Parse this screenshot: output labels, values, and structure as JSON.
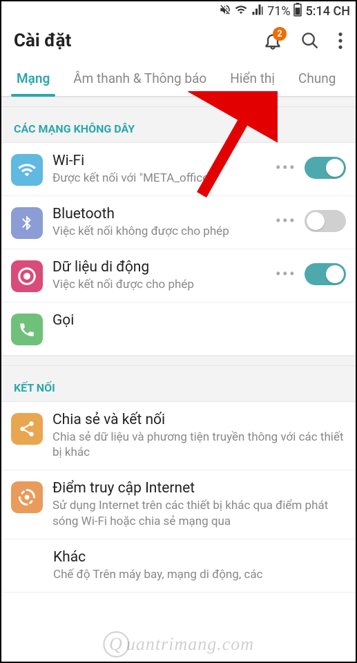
{
  "status": {
    "battery": "71%",
    "time": "5:14 CH"
  },
  "header": {
    "title": "Cài đặt",
    "badge": "2"
  },
  "tabs": [
    {
      "label": "Mạng",
      "active": true
    },
    {
      "label": "Âm thanh & Thông báo",
      "active": false
    },
    {
      "label": "Hiển thị",
      "active": false
    },
    {
      "label": "Chung",
      "active": false
    }
  ],
  "sections": {
    "wireless_header": "CÁC MẠNG KHÔNG DÂY",
    "connect_header": "KẾT NỐI"
  },
  "items": {
    "wifi": {
      "title": "Wi-Fi",
      "sub": "Được kết nối với \"META_office\""
    },
    "bluetooth": {
      "title": "Bluetooth",
      "sub": "Việc kết nối không được cho phép"
    },
    "mobiledata": {
      "title": "Dữ liệu di động",
      "sub": "Việc kết nối được cho phép"
    },
    "call": {
      "title": "Gọi",
      "sub": ""
    },
    "share": {
      "title": "Chia sẻ và kết nối",
      "sub": "Chia sẻ dữ liệu và phương tiện truyền thông với các thiết bị khác"
    },
    "hotspot": {
      "title": "Điểm truy cập Internet",
      "sub": "Sử dụng Internet trên các thiết bị khác qua điểm phát sóng Wi-Fi hoặc chia sẻ mạng qua"
    },
    "other": {
      "title": "Khác",
      "sub": "Chế độ Trên máy bay, mạng di động, các"
    }
  },
  "watermark": "uantrimang.com"
}
